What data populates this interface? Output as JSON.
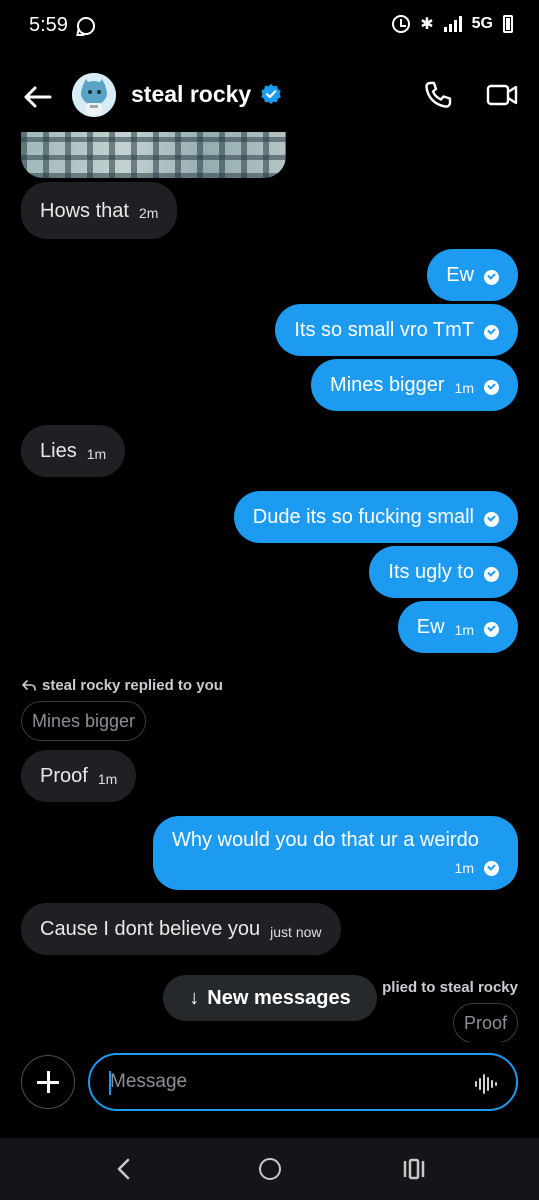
{
  "status_bar": {
    "time": "5:59",
    "network": "5G",
    "icons": [
      "chat-bubble-icon",
      "alarm-icon",
      "bluetooth-icon",
      "signal-icon",
      "battery-icon"
    ]
  },
  "header": {
    "name": "steal rocky",
    "verified": true,
    "icons": [
      "back-arrow-icon",
      "avatar",
      "verified-icon",
      "phone-call-icon",
      "video-call-icon"
    ]
  },
  "messages": [
    {
      "side": "in",
      "text": "Hows that",
      "time": "2m"
    },
    {
      "side": "out",
      "text": "Ew",
      "time": ""
    },
    {
      "side": "out",
      "text": "Its so small vro TmT",
      "time": ""
    },
    {
      "side": "out",
      "text": "Mines bigger",
      "time": "1m"
    },
    {
      "side": "in",
      "text": "Lies",
      "time": "1m"
    },
    {
      "side": "out",
      "text": "Dude its so fucking small",
      "time": ""
    },
    {
      "side": "out",
      "text": "Its ugly to",
      "time": ""
    },
    {
      "side": "out",
      "text": "Ew",
      "time": "1m"
    },
    {
      "side": "in",
      "text": "Proof",
      "time": "1m",
      "reply_note": "steal rocky replied to you",
      "quoted": "Mines bigger"
    },
    {
      "side": "out",
      "text": "Why would you do that ur a weirdo",
      "time": "1m"
    },
    {
      "side": "in",
      "text": "Cause I dont believe you",
      "time": "just now"
    },
    {
      "side": "out",
      "text": "",
      "reply_note": "plied to steal rocky",
      "quoted": "Proof"
    }
  ],
  "new_messages_button": {
    "label": "New messages",
    "icon": "arrow-down-icon"
  },
  "composer": {
    "placeholder": "Message",
    "icons": [
      "plus-icon",
      "voice-wave-icon"
    ]
  },
  "nav_bar": {
    "icons": [
      "nav-back-icon",
      "nav-home-icon",
      "nav-recents-icon"
    ]
  },
  "colors": {
    "accent": "#1d9bf0",
    "incoming_bubble": "#1e2023",
    "background": "#000000"
  }
}
